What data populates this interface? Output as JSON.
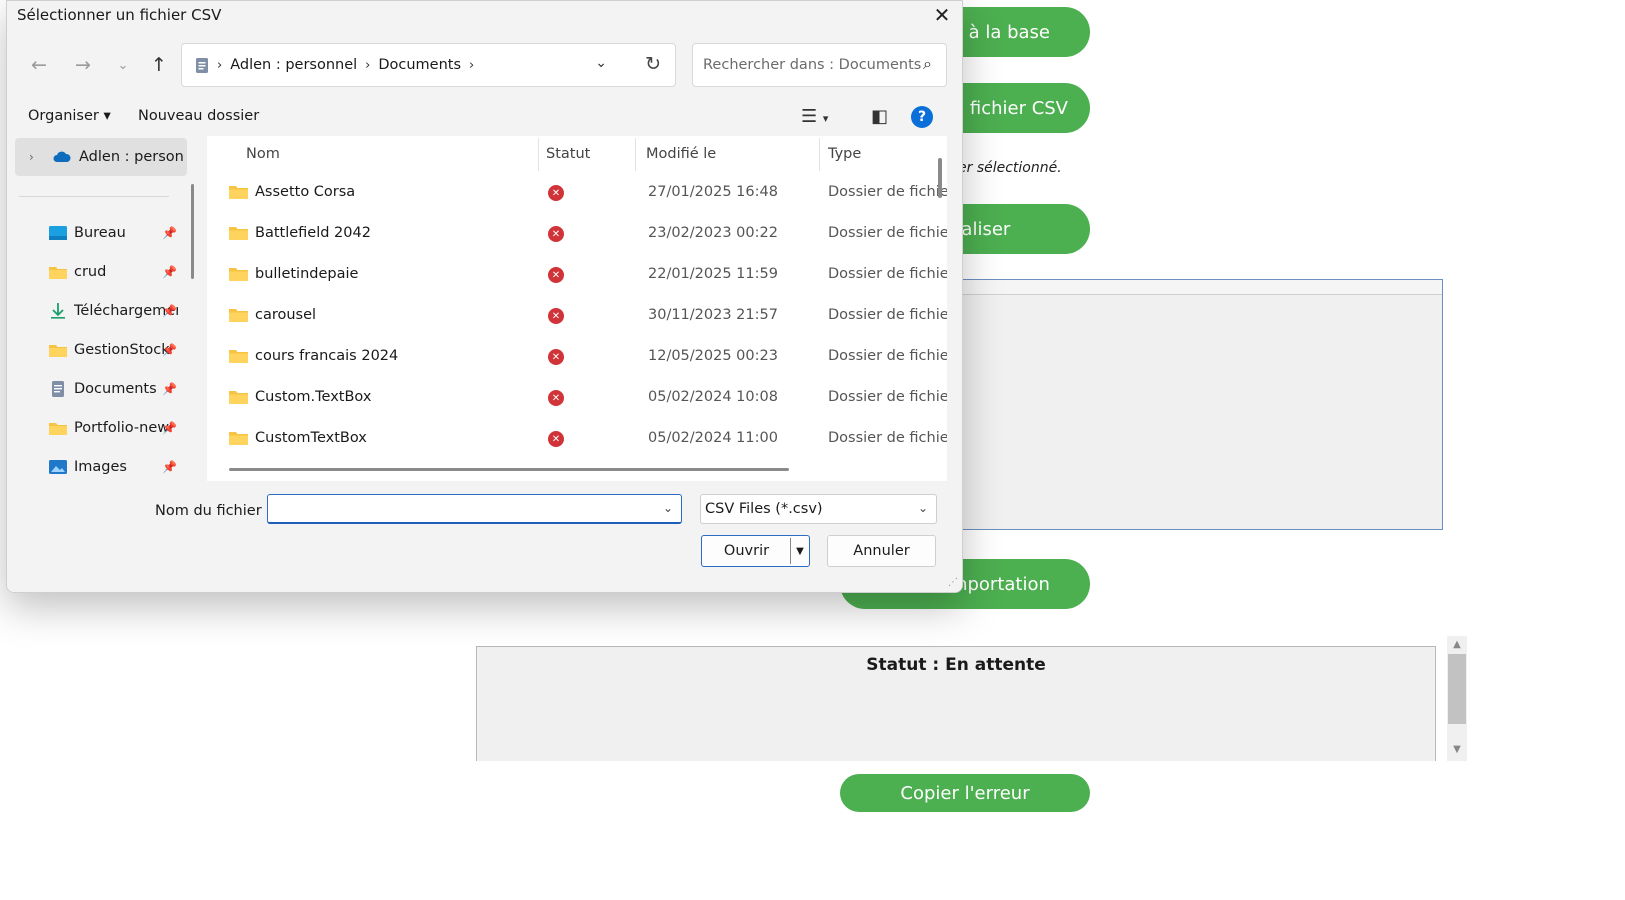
{
  "background": {
    "buttons": {
      "connect": "on à la base",
      "choose_csv": "un fichier CSV",
      "preview": "ualiser",
      "import": "'importation",
      "copy_error": "Copier l'erreur"
    },
    "file_status": "er sélectionné.",
    "status_text": "Statut : En attente",
    "accent_color": "#4caf50"
  },
  "dialog": {
    "title": "Sélectionner un fichier CSV",
    "breadcrumb": [
      "Adlen : personnel",
      "Documents"
    ],
    "search_placeholder": "Rechercher dans : Documents",
    "toolbar": {
      "organize": "Organiser",
      "new_folder": "Nouveau dossier"
    },
    "nav": {
      "root": "Adlen : personnel",
      "items": [
        {
          "label": "Bureau",
          "icon": "desktop-icon"
        },
        {
          "label": "crud",
          "icon": "folder-icon"
        },
        {
          "label": "Téléchargements",
          "icon": "download-icon"
        },
        {
          "label": "GestionStock",
          "icon": "folder-icon"
        },
        {
          "label": "Documents",
          "icon": "documents-icon"
        },
        {
          "label": "Portfolio-new",
          "icon": "folder-icon"
        },
        {
          "label": "Images",
          "icon": "images-icon"
        }
      ]
    },
    "columns": [
      "Nom",
      "Statut",
      "Modifié le",
      "Type"
    ],
    "files": [
      {
        "name": "Assetto Corsa",
        "date": "27/01/2025 16:48",
        "type": "Dossier de fichiers"
      },
      {
        "name": "Battlefield 2042",
        "date": "23/02/2023 00:22",
        "type": "Dossier de fichiers"
      },
      {
        "name": "bulletindepaie",
        "date": "22/01/2025 11:59",
        "type": "Dossier de fichiers"
      },
      {
        "name": "carousel",
        "date": "30/11/2023 21:57",
        "type": "Dossier de fichiers"
      },
      {
        "name": "cours francais 2024",
        "date": "12/05/2025 00:23",
        "type": "Dossier de fichiers"
      },
      {
        "name": "Custom.TextBox",
        "date": "05/02/2024 10:08",
        "type": "Dossier de fichiers"
      },
      {
        "name": "CustomTextBox",
        "date": "05/02/2024 11:00",
        "type": "Dossier de fichiers"
      }
    ],
    "filename_label": "Nom du fichier :",
    "filename_value": "",
    "filetype": "CSV Files (*.csv)",
    "open_button": "Ouvrir",
    "cancel_button": "Annuler"
  }
}
